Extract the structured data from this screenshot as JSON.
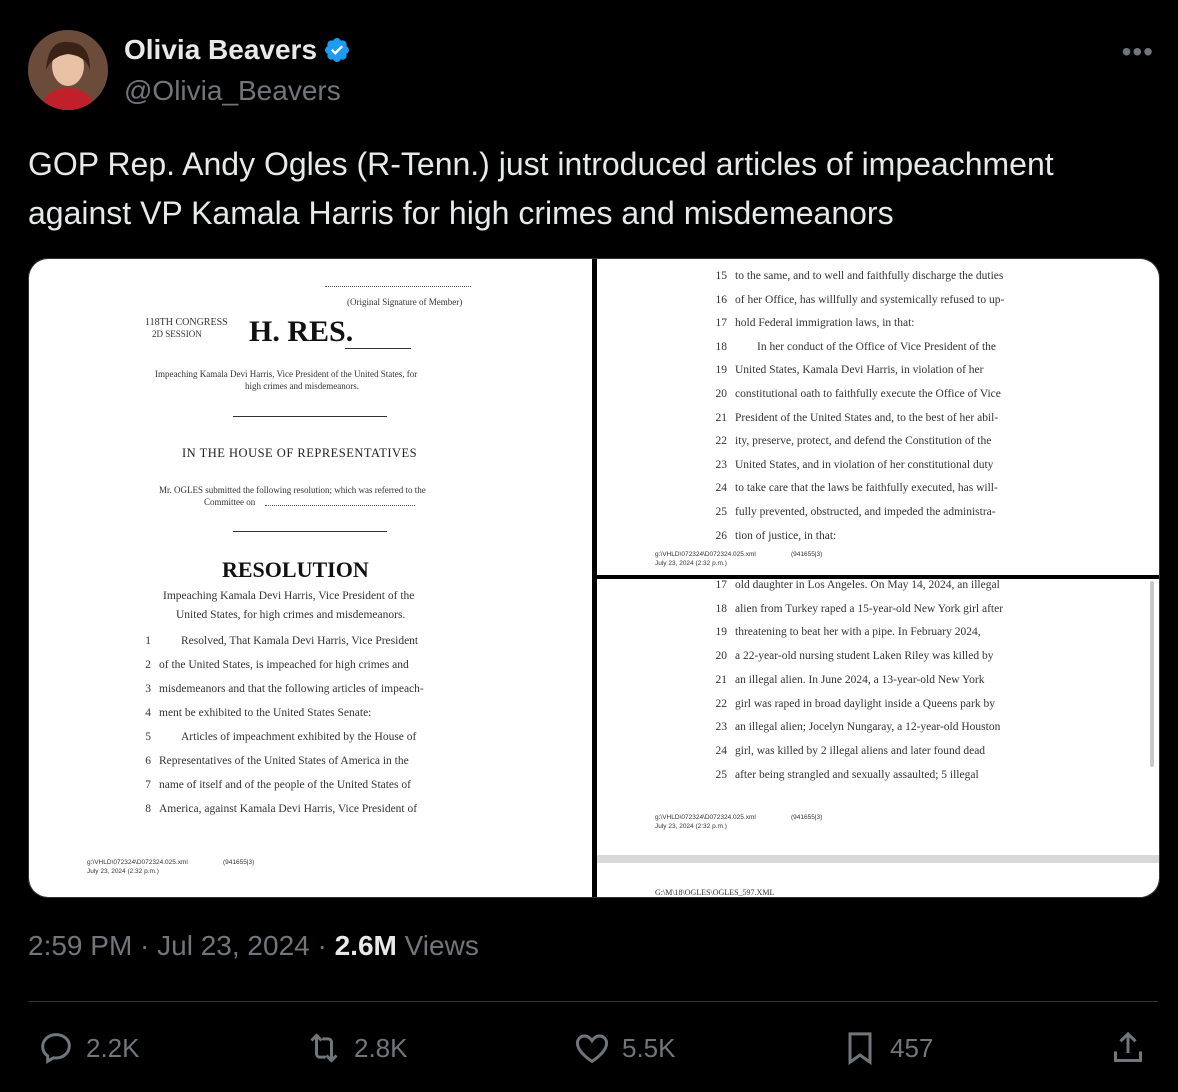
{
  "author": {
    "name": "Olivia Beavers",
    "handle": "@Olivia_Beavers",
    "verified": true
  },
  "more_icon": "more-horizontal-icon",
  "text": "GOP Rep. Andy Ogles (R-Tenn.) just introduced articles of impeachment against VP Kamala Harris for high crimes and misdemeanors",
  "doc1": {
    "sig": "(Original Signature of Member)",
    "congress": "118TH CONGRESS",
    "session": "2D SESSION",
    "hres": "H. RES.",
    "subtitle_a": "Impeaching Kamala Devi Harris, Vice President of the United States, for",
    "subtitle_b": "high crimes and misdemeanors.",
    "house": "IN THE HOUSE OF REPRESENTATIVES",
    "submitted_a": "Mr. OGLES submitted the following resolution; which was referred to the",
    "submitted_b": "Committee on",
    "resolution": "RESOLUTION",
    "res_sub_a": "Impeaching Kamala Devi Harris, Vice President of the",
    "res_sub_b": "United States, for high crimes and misdemeanors.",
    "lines": [
      {
        "n": "1",
        "t": "Resolved, That Kamala Devi Harris, Vice President"
      },
      {
        "n": "2",
        "t": "of the United States, is impeached for high crimes and"
      },
      {
        "n": "3",
        "t": "misdemeanors and that the following articles of impeach-"
      },
      {
        "n": "4",
        "t": "ment be exhibited to the United States Senate:"
      },
      {
        "n": "5",
        "t": "Articles of impeachment exhibited by the House of"
      },
      {
        "n": "6",
        "t": "Representatives of the United States of America in the"
      },
      {
        "n": "7",
        "t": "name of itself and of the people of the United States of"
      },
      {
        "n": "8",
        "t": "America, against Kamala Devi Harris, Vice President of"
      }
    ],
    "footer_a": "g:\\VHLD\\072324\\D072324.025.xml",
    "footer_code": "(941655|3)",
    "footer_b": "July 23, 2024 (2:32 p.m.)"
  },
  "doc2": {
    "lines": [
      {
        "n": "15",
        "t": "to the same, and to well and faithfully discharge the duties"
      },
      {
        "n": "16",
        "t": "of her Office, has willfully and systemically refused to up-"
      },
      {
        "n": "17",
        "t": "hold Federal immigration laws, in that:"
      },
      {
        "n": "18",
        "t": "In her conduct of the Office of Vice President of the"
      },
      {
        "n": "19",
        "t": "United States, Kamala Devi Harris, in violation of her"
      },
      {
        "n": "20",
        "t": "constitutional oath to faithfully execute the Office of Vice"
      },
      {
        "n": "21",
        "t": "President of the United States and, to the best of her abil-"
      },
      {
        "n": "22",
        "t": "ity, preserve, protect, and defend the Constitution of the"
      },
      {
        "n": "23",
        "t": "United States, and in violation of her constitutional duty"
      },
      {
        "n": "24",
        "t": "to take care that the laws be faithfully executed, has will-"
      },
      {
        "n": "25",
        "t": "fully prevented, obstructed, and impeded the administra-"
      },
      {
        "n": "26",
        "t": "tion of justice, in that:"
      }
    ],
    "footer_a": "g:\\VHLD\\072324\\D072324.025.xml",
    "footer_code": "(941655|3)",
    "footer_b": "July 23, 2024 (2:32 p.m.)"
  },
  "doc3": {
    "lines": [
      {
        "n": "17",
        "t": "old daughter in Los Angeles. On May 14, 2024, an illegal"
      },
      {
        "n": "18",
        "t": "alien from Turkey raped a 15-year-old New York girl after"
      },
      {
        "n": "19",
        "t": "threatening to beat her with a pipe. In February 2024,"
      },
      {
        "n": "20",
        "t": "a 22-year-old nursing student Laken Riley was killed by"
      },
      {
        "n": "21",
        "t": "an illegal alien. In June 2024, a 13-year-old New York"
      },
      {
        "n": "22",
        "t": "girl was raped in broad daylight inside a Queens park by"
      },
      {
        "n": "23",
        "t": "an illegal alien; Jocelyn Nungaray, a 12-year-old Houston"
      },
      {
        "n": "24",
        "t": "girl, was killed by 2 illegal aliens and later found dead"
      },
      {
        "n": "25",
        "t": "after being strangled and sexually assaulted; 5 illegal"
      }
    ],
    "footer_a": "g:\\VHLD\\072324\\D072324.025.xml",
    "footer_code": "(941655|3)",
    "footer_b": "July 23, 2024 (2:32 p.m.)",
    "next_header": "G:\\M\\18\\OGLES\\OGLES_597.XML"
  },
  "meta": {
    "time": "2:59 PM · Jul 23, 2024 · ",
    "views_count": "2.6M",
    "views_label": " Views"
  },
  "actions": {
    "reply": {
      "icon": "reply-icon",
      "count": "2.2K"
    },
    "retweet": {
      "icon": "retweet-icon",
      "count": "2.8K"
    },
    "like": {
      "icon": "heart-icon",
      "count": "5.5K"
    },
    "bookmark": {
      "icon": "bookmark-icon",
      "count": "457"
    },
    "share": {
      "icon": "share-icon"
    }
  },
  "colors": {
    "background": "#000000",
    "text": "#e7e9ea",
    "muted": "#71767b",
    "verified": "#1d9bf0"
  }
}
